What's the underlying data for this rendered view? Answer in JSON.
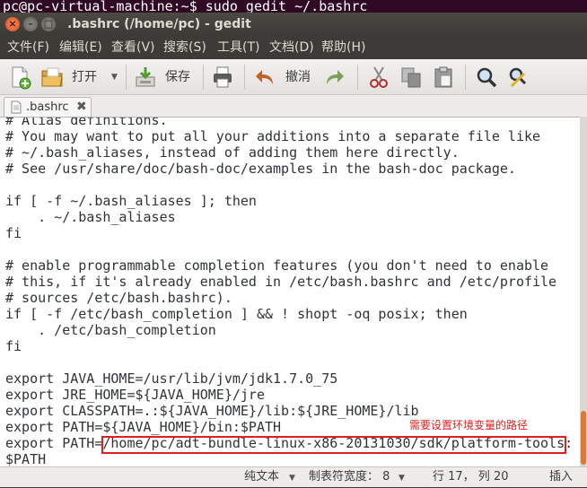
{
  "terminal": {
    "prompt_line": "pc@pc-virtual-machine:~$ sudo gedit ~/.bashrc"
  },
  "window": {
    "title": ".bashrc (/home/pc) - gedit",
    "close_glyph": "×",
    "minimize_glyph": "–",
    "maximize_glyph": "□"
  },
  "menubar": {
    "items": [
      {
        "label": "文件(F)"
      },
      {
        "label": "编辑(E)"
      },
      {
        "label": "查看(V)"
      },
      {
        "label": "搜索(S)"
      },
      {
        "label": "工具(T)"
      },
      {
        "label": "文档(D)"
      },
      {
        "label": "帮助(H)"
      }
    ]
  },
  "toolbar": {
    "open_label": "打开",
    "save_label": "保存",
    "undo_label": "撤消",
    "icons": [
      "new-document-icon",
      "open-folder-icon",
      "save-icon",
      "print-icon",
      "undo-icon",
      "redo-icon",
      "cut-icon",
      "copy-icon",
      "paste-icon",
      "search-icon",
      "search-replace-icon"
    ]
  },
  "tab": {
    "label": ".bashrc",
    "close_glyph": "✖"
  },
  "editor": {
    "lines": [
      "# Alias definitions.",
      "# You may want to put all your additions into a separate file like",
      "# ~/.bash_aliases, instead of adding them here directly.",
      "# See /usr/share/doc/bash-doc/examples in the bash-doc package.",
      "",
      "if [ -f ~/.bash_aliases ]; then",
      "    . ~/.bash_aliases",
      "fi",
      "",
      "# enable programmable completion features (you don't need to enable",
      "# this, if it's already enabled in /etc/bash.bashrc and /etc/profile",
      "# sources /etc/bash.bashrc).",
      "if [ -f /etc/bash_completion ] && ! shopt -oq posix; then",
      "    . /etc/bash_completion",
      "fi",
      "",
      "export JAVA_HOME=/usr/lib/jvm/jdk1.7.0_75",
      "export JRE_HOME=${JAVA_HOME}/jre",
      "export CLASSPATH=.:${JAVA_HOME}/lib:${JRE_HOME}/lib",
      "export PATH=${JAVA_HOME}/bin:$PATH",
      "export PATH=/home/pc/adt-bundle-linux-x86-20131030/sdk/platform-tools:",
      "$PATH"
    ],
    "annotation": "需要设置环境变量的路径",
    "annotation_color": "#e02020"
  },
  "statusbar": {
    "language": "纯文本",
    "tab_width": "制表符宽度： 8",
    "position": "行 17， 列 20",
    "mode": "插入"
  },
  "colors": {
    "terminal_bg": "#300a24",
    "titlebar_bg": "#3c3b37",
    "accent": "#e07a2a"
  }
}
